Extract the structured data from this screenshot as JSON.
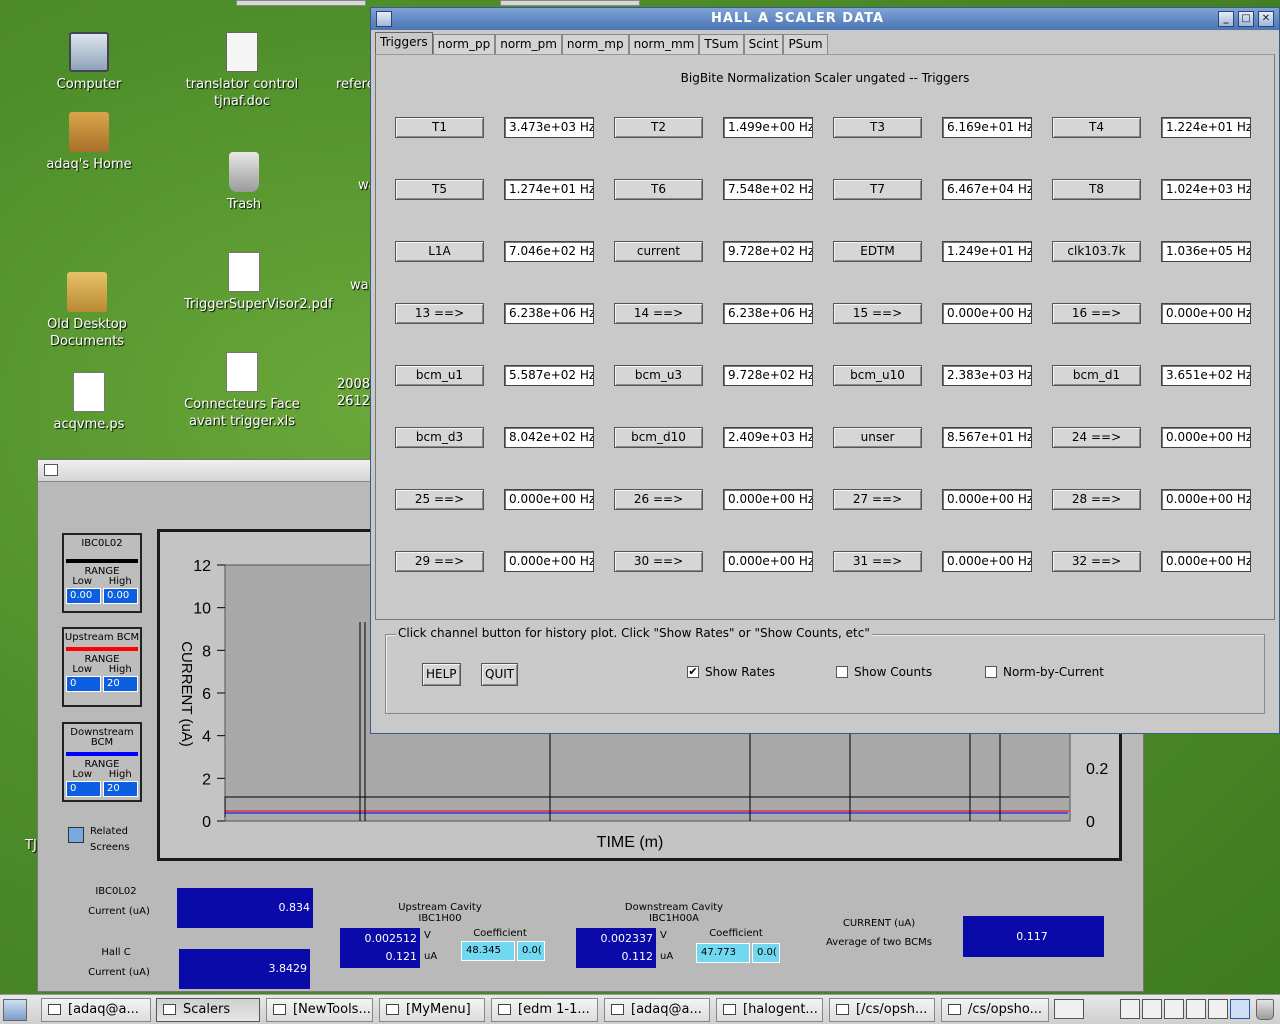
{
  "desktop": {
    "icons": [
      {
        "label": "Computer",
        "icon": "computer-icon"
      },
      {
        "label": "translator control tjnaf.doc",
        "icon": "document-icon"
      },
      {
        "label": "adaq's Home",
        "icon": "home-folder-icon"
      },
      {
        "label": "Trash",
        "icon": "trash-icon"
      },
      {
        "label": "Old Desktop Documents",
        "icon": "folder-icon"
      },
      {
        "label": "TriggerSuperVisor2.pdf",
        "icon": "pdf-icon"
      },
      {
        "label": "Connecteurs Face avant trigger.xls",
        "icon": "spreadsheet-icon"
      },
      {
        "label": "acqvme.ps",
        "icon": "postscript-icon"
      }
    ],
    "partial_labels": [
      "refere",
      "wa",
      "wal",
      "2008",
      "2612",
      "TJ"
    ]
  },
  "scaler_window": {
    "title": "HALL  A   SCALER   DATA",
    "tabs": [
      "Triggers",
      "norm_pp",
      "norm_pm",
      "norm_mp",
      "norm_mm",
      "TSum",
      "Scint",
      "PSum"
    ],
    "active_tab": "Triggers",
    "subtitle": "BigBite Normalization Scaler ungated -- Triggers",
    "rows": [
      [
        {
          "name": "T1",
          "value": "3.473e+03 Hz"
        },
        {
          "name": "T2",
          "value": "1.499e+00 Hz"
        },
        {
          "name": "T3",
          "value": "6.169e+01 Hz"
        },
        {
          "name": "T4",
          "value": "1.224e+01 Hz"
        }
      ],
      [
        {
          "name": "T5",
          "value": "1.274e+01 Hz"
        },
        {
          "name": "T6",
          "value": "7.548e+02 Hz"
        },
        {
          "name": "T7",
          "value": "6.467e+04 Hz"
        },
        {
          "name": "T8",
          "value": "1.024e+03 Hz"
        }
      ],
      [
        {
          "name": "L1A",
          "value": "7.046e+02 Hz"
        },
        {
          "name": "current",
          "value": "9.728e+02 Hz"
        },
        {
          "name": "EDTM",
          "value": "1.249e+01 Hz"
        },
        {
          "name": "clk103.7k",
          "value": "1.036e+05 Hz"
        }
      ],
      [
        {
          "name": "13 ==>",
          "value": "6.238e+06 Hz"
        },
        {
          "name": "14 ==>",
          "value": "6.238e+06 Hz"
        },
        {
          "name": "15 ==>",
          "value": "0.000e+00 Hz"
        },
        {
          "name": "16 ==>",
          "value": "0.000e+00 Hz"
        }
      ],
      [
        {
          "name": "bcm_u1",
          "value": "5.587e+02 Hz"
        },
        {
          "name": "bcm_u3",
          "value": "9.728e+02 Hz"
        },
        {
          "name": "bcm_u10",
          "value": "2.383e+03 Hz"
        },
        {
          "name": "bcm_d1",
          "value": "3.651e+02 Hz"
        }
      ],
      [
        {
          "name": "bcm_d3",
          "value": "8.042e+02 Hz"
        },
        {
          "name": "bcm_d10",
          "value": "2.409e+03 Hz"
        },
        {
          "name": "unser",
          "value": "8.567e+01 Hz"
        },
        {
          "name": "24 ==>",
          "value": "0.000e+00 Hz"
        }
      ],
      [
        {
          "name": "25 ==>",
          "value": "0.000e+00 Hz"
        },
        {
          "name": "26 ==>",
          "value": "0.000e+00 Hz"
        },
        {
          "name": "27 ==>",
          "value": "0.000e+00 Hz"
        },
        {
          "name": "28 ==>",
          "value": "0.000e+00 Hz"
        }
      ],
      [
        {
          "name": "29 ==>",
          "value": "0.000e+00 Hz"
        },
        {
          "name": "30 ==>",
          "value": "0.000e+00 Hz"
        },
        {
          "name": "31 ==>",
          "value": "0.000e+00 Hz"
        },
        {
          "name": "32 ==>",
          "value": "0.000e+00 Hz"
        }
      ]
    ],
    "controls": {
      "hint": "Click channel button for history plot.  Click \"Show Rates\" or \"Show Counts, etc\"",
      "help": "HELP",
      "quit": "QUIT",
      "show_rates": "Show Rates",
      "show_rates_checked": true,
      "show_counts": "Show Counts",
      "show_counts_checked": false,
      "norm_by_current": "Norm-by-Current",
      "norm_by_current_checked": false
    }
  },
  "strip_chart": {
    "legends": [
      {
        "name": "IBC0L02",
        "color": "#000000",
        "range": "RANGE",
        "low_label": "Low",
        "high_label": "High",
        "low": "0.00",
        "high": "0.00"
      },
      {
        "name": "Upstream BCM",
        "color": "#ff0000",
        "range": "RANGE",
        "low_label": "Low",
        "high_label": "High",
        "low": "0",
        "high": "20"
      },
      {
        "name": "Downstream BCM",
        "color": "#0000ff",
        "range": "RANGE",
        "low_label": "Low",
        "high_label": "High",
        "low": "0",
        "high": "20"
      }
    ],
    "related_screens": "Related Screens",
    "y_ticks": [
      "12",
      "10",
      "8",
      "6",
      "4",
      "2",
      "0"
    ],
    "right_ticks": [
      "0.2",
      "0"
    ],
    "y_label": "CURRENT (uA)",
    "x_label": "TIME (m)",
    "ibc": {
      "name": "IBC0L02",
      "unit": "Current (uA)",
      "value": "0.834"
    },
    "hallc": {
      "name": "Hall C",
      "unit": "Current (uA)",
      "value": "3.8429"
    },
    "upstream": {
      "title": "Upstream Cavity",
      "sub": "IBC1H00",
      "v": "0.002512",
      "v_unit": "V",
      "ua": "0.121",
      "ua_unit": "uA",
      "coef_label": "Coefficient",
      "coef": "48.345",
      "coef2": "0.0("
    },
    "downstream": {
      "title": "Downstream Cavity",
      "sub": "IBC1H00A",
      "v": "0.002337",
      "v_unit": "V",
      "ua": "0.112",
      "ua_unit": "uA",
      "coef_label": "Coefficient",
      "coef": "47.773",
      "coef2": "0.0("
    },
    "average": {
      "title": "CURRENT (uA)",
      "sub": "Average of two BCMs",
      "value": "0.117"
    }
  },
  "taskbar": {
    "tasks": [
      "[adaq@a...",
      "Scalers",
      "[NewTools...",
      "[MyMenu]",
      "[edm 1-1...",
      "[adaq@a...",
      "[halogent...",
      "[/cs/opsh...",
      "/cs/opsho..."
    ],
    "active_task": "Scalers"
  }
}
